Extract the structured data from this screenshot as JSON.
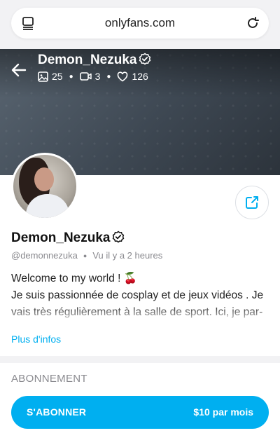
{
  "browser": {
    "url": "onlyfans.com",
    "tabs_icon": "tabs-icon",
    "reload_icon": "reload-icon"
  },
  "cover": {
    "image": "cover-photo-placeholder",
    "back_icon": "back-arrow-icon",
    "name": "Demon_Nezuka",
    "verified_icon": "verified-badge-icon",
    "stats": {
      "photos": "25",
      "videos": "3",
      "likes": "126"
    }
  },
  "profile": {
    "avatar": "avatar",
    "share_icon": "share-icon",
    "name": "Demon_Nezuka",
    "handle": "@demonnezuka",
    "last_seen": "Vu  il y a 2 heures",
    "bio_line1": "Welcome to my world ! 🍒",
    "bio_line2": "Je suis passionnée de cosplay et de jeux vidéos . Je vais très régulièrement à la salle de sport. Ici, je par-",
    "more_info": "Plus d'infos"
  },
  "subscription": {
    "section_title": "ABONNEMENT",
    "button_label": "S'ABONNER",
    "price": "$10 par mois"
  },
  "colors": {
    "accent": "#00aff0",
    "muted": "#8a8a8f"
  }
}
